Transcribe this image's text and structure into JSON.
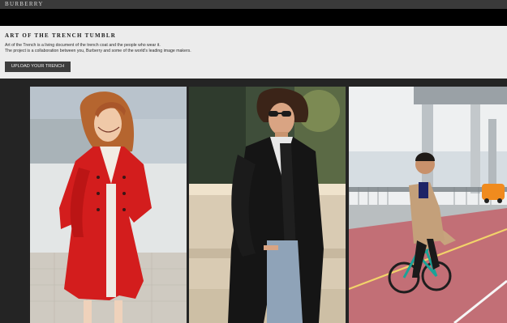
{
  "brand": {
    "name": "BURBERRY"
  },
  "header": {
    "title": "ART OF THE TRENCH TUMBLR",
    "description_line1": "Art of the Trench is a living document of the trench coat and the people who wear it.",
    "description_line2": "The project is a collaboration between you, Burberry and some of the world's leading image makers.",
    "upload_label": "UPLOAD YOUR TRENCH"
  },
  "colors": {
    "topbar": "#3a3a3a",
    "header_bg": "#ececec",
    "page_bg": "#242424",
    "button_bg": "#3d3d3d"
  },
  "gallery": {
    "photos": [
      {
        "subject": "woman-red-trench-photo"
      },
      {
        "subject": "man-black-trench-sunglasses-photo"
      },
      {
        "subject": "man-beige-trench-bicycle-photo"
      }
    ]
  }
}
